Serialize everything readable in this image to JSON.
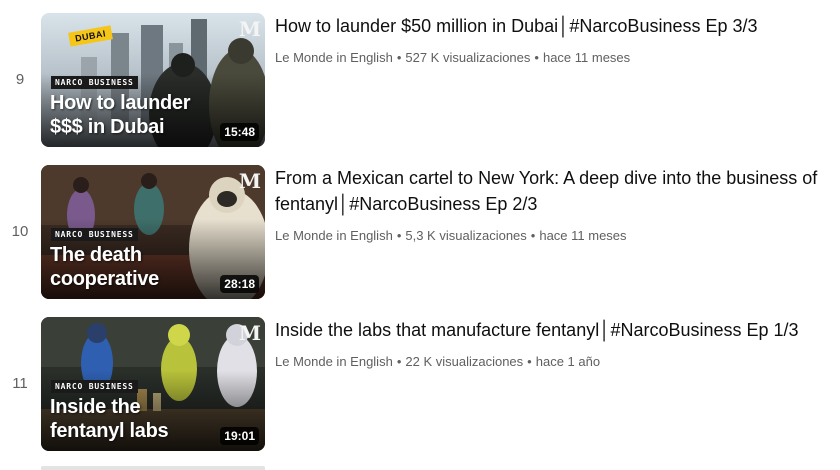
{
  "videos": [
    {
      "index": "9",
      "series_tag": "NARCO BUSINESS",
      "thumb_badge": "DUBAI",
      "thumb_title": "How to launder\n$$$ in Dubai",
      "duration": "15:48",
      "title": "How to launder $50 million in Dubai│#NarcoBusiness Ep 3/3",
      "channel": "Le Monde in English",
      "views": "527 K visualizaciones",
      "age": "hace 11 meses"
    },
    {
      "index": "10",
      "series_tag": "NARCO BUSINESS",
      "thumb_title": "The death\ncooperative",
      "duration": "28:18",
      "title": "From a Mexican cartel to New York: A deep dive into the business of fentanyl│#NarcoBusiness Ep 2/3",
      "channel": "Le Monde in English",
      "views": "5,3 K visualizaciones",
      "age": "hace 11 meses"
    },
    {
      "index": "11",
      "series_tag": "NARCO BUSINESS",
      "thumb_title": "Inside the\nfentanyl labs",
      "duration": "19:01",
      "title": "Inside the labs that manufacture fentanyl│#NarcoBusiness Ep 1/3",
      "channel": "Le Monde in English",
      "views": "22 K visualizaciones",
      "age": "hace 1 año"
    }
  ],
  "meta_separator": "•",
  "brand_glyph": "M",
  "colors": {
    "title_text": "#0f0f0f",
    "meta_text": "#606060",
    "duration_bg": "#000000",
    "dubai_badge": "#f5c518"
  }
}
